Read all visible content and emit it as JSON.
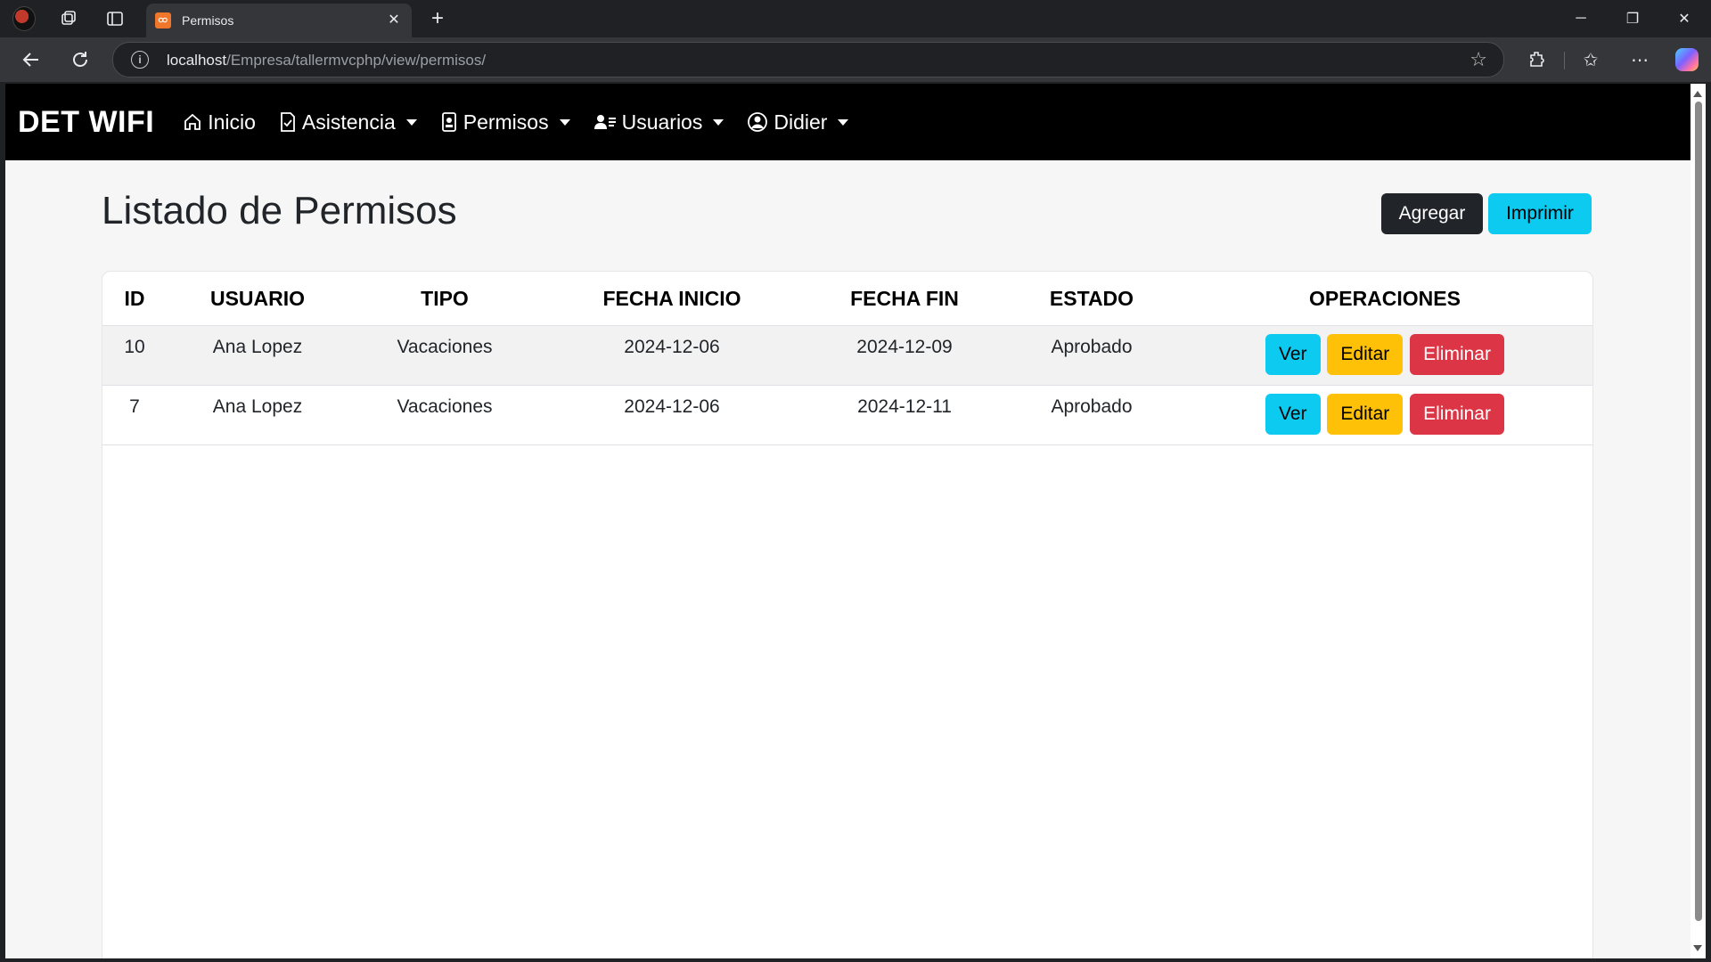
{
  "browser": {
    "tab_title": "Permisos",
    "tab_favicon_text": "ထ",
    "url_host": "localhost",
    "url_path": "/Empresa/tallermvcphp/view/permisos/"
  },
  "navbar": {
    "brand": "DET WIFI",
    "items": [
      {
        "label": "Inicio",
        "icon": "home-icon",
        "dropdown": false
      },
      {
        "label": "Asistencia",
        "icon": "clipboard-check-icon",
        "dropdown": true
      },
      {
        "label": "Permisos",
        "icon": "id-badge-icon",
        "dropdown": true
      },
      {
        "label": "Usuarios",
        "icon": "users-icon",
        "dropdown": true
      },
      {
        "label": "Didier",
        "icon": "user-circle-icon",
        "dropdown": true
      }
    ]
  },
  "page": {
    "title": "Listado de Permisos",
    "add_label": "Agregar",
    "print_label": "Imprimir"
  },
  "table": {
    "headers": [
      "ID",
      "USUARIO",
      "TIPO",
      "FECHA INICIO",
      "FECHA FIN",
      "ESTADO",
      "OPERACIONES"
    ],
    "rows": [
      {
        "id": "10",
        "usuario": "Ana Lopez",
        "tipo": "Vacaciones",
        "fecha_inicio": "2024-12-06",
        "fecha_fin": "2024-12-09",
        "estado": "Aprobado"
      },
      {
        "id": "7",
        "usuario": "Ana Lopez",
        "tipo": "Vacaciones",
        "fecha_inicio": "2024-12-06",
        "fecha_fin": "2024-12-11",
        "estado": "Aprobado"
      }
    ],
    "operations": {
      "view": "Ver",
      "edit": "Editar",
      "delete": "Eliminar"
    }
  },
  "colors": {
    "navbar_bg": "#000000",
    "btn_dark": "#212529",
    "btn_info": "#0dcaf0",
    "btn_warning": "#ffc107",
    "btn_danger": "#dc3545"
  }
}
